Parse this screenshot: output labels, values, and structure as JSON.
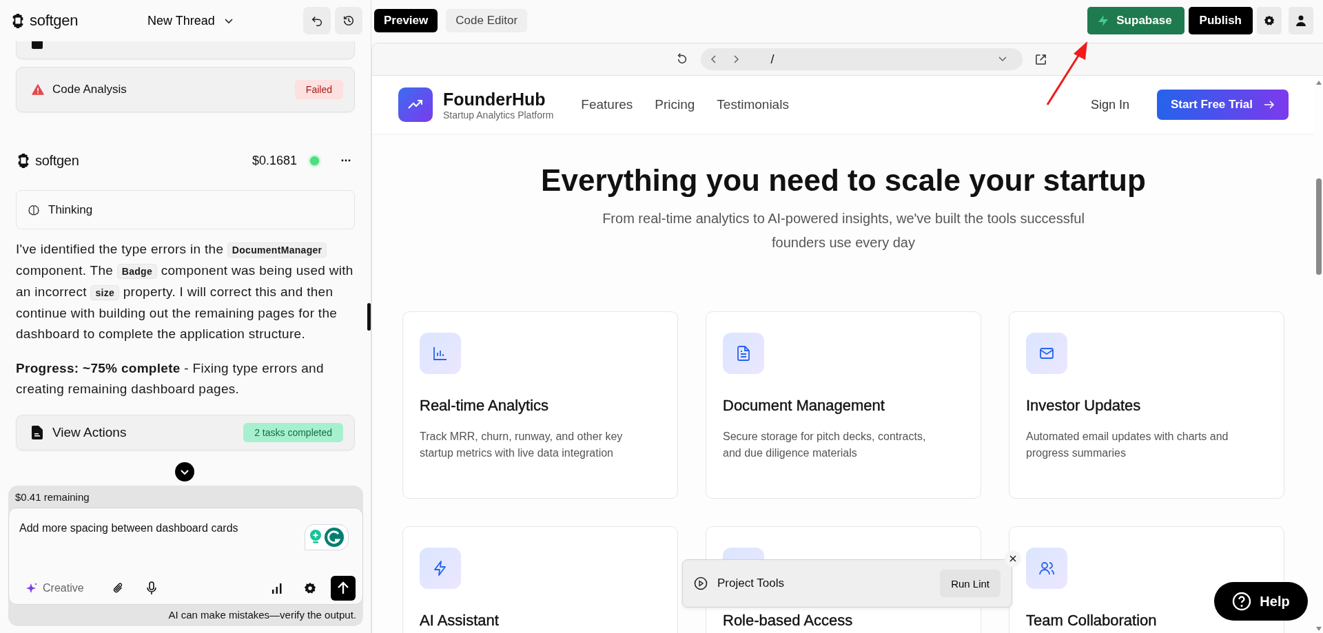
{
  "header": {
    "brand": "softgen",
    "thread_title": "New Thread"
  },
  "chat": {
    "analysis_card": {
      "title": "Code Analysis",
      "badge": "Failed",
      "color": "#fde0e0"
    },
    "message": {
      "author": "softgen",
      "cost": "$0.1681",
      "online": true,
      "thinking": "Thinking",
      "paragraph": [
        {
          "text": "I've identified the type errors in the "
        },
        {
          "code": "DocumentManager"
        },
        {
          "text": " component. The "
        },
        {
          "code": "Badge"
        },
        {
          "text": " component was being used with an incorrect "
        },
        {
          "code": "size"
        },
        {
          "text": " property. I will correct this and then continue with building out the remaining pages for the dashboard to complete the application structure."
        }
      ],
      "progress": "**Progress: ~75% complete** - Fixing type errors and creating remaining dashboard pages.",
      "actions": {
        "title": "View Actions",
        "badge": "2 tasks completed",
        "color": "#a7f0cf"
      }
    }
  },
  "composer": {
    "remaining": "$0.41 remaining",
    "value": "Add more spacing between dashboard cards",
    "mode": "Creative",
    "disclaimer": "AI can make mistakes—verify the output."
  },
  "toolbar": {
    "tabs": [
      {
        "label": "Preview",
        "selected": true
      },
      {
        "label": "Code Editor",
        "selected": false
      }
    ],
    "supabase": "Supabase",
    "publish": "Publish"
  },
  "browser": {
    "path": "/"
  },
  "site": {
    "brand": "FounderHub",
    "tagline": "Startup Analytics Platform",
    "nav": [
      "Features",
      "Pricing",
      "Testimonials"
    ],
    "sign_in": "Sign In",
    "cta": "Start Free Trial",
    "headline": "Everything you need to scale your startup",
    "subhead": "From real-time analytics to AI-powered insights, we've built the tools successful founders use every day",
    "features": [
      {
        "title": "Real-time Analytics",
        "description": "Track MRR, churn, runway, and other key startup metrics with live data integration"
      },
      {
        "title": "Document Management",
        "description": "Secure storage for pitch decks, contracts, and due diligence materials"
      },
      {
        "title": "Investor Updates",
        "description": "Automated email updates with charts and progress summaries"
      },
      {
        "title": "AI Assistant"
      },
      {
        "title": "Role-based Access"
      },
      {
        "title": "Team Collaboration"
      }
    ]
  },
  "project_tools": {
    "title": "Project Tools",
    "action": "Run Lint"
  },
  "help": "Help"
}
